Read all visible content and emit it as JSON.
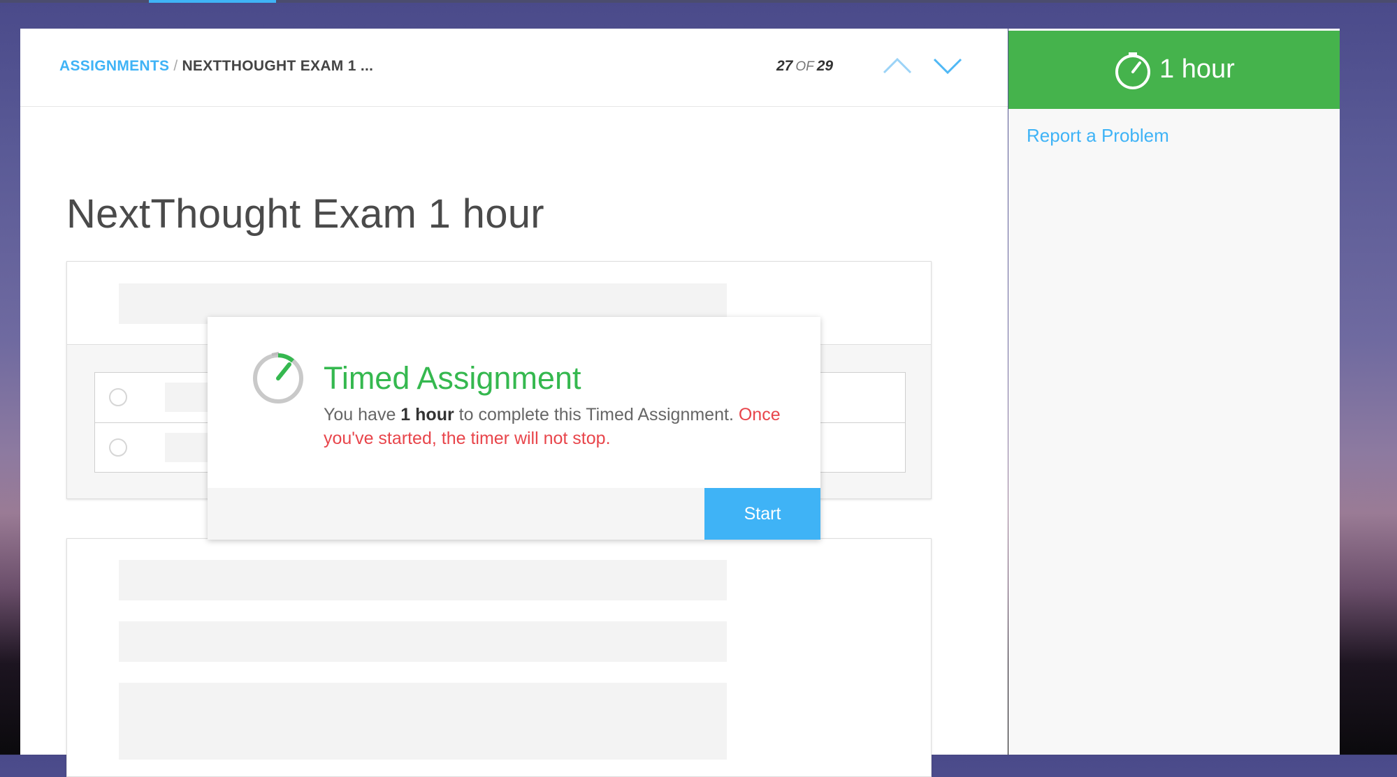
{
  "colors": {
    "accent": "#3fb3f6",
    "timer_green": "#45b34c",
    "dialog_title_green": "#35b84f",
    "warning_red": "#e8454b"
  },
  "header": {
    "breadcrumb_link": "ASSIGNMENTS",
    "breadcrumb_separator": "/",
    "breadcrumb_current": "NEXTTHOUGHT EXAM 1 ...",
    "pager_current": "27",
    "pager_of": "OF",
    "pager_total": "29",
    "icons": {
      "previous": "chevron-up-icon",
      "next": "chevron-down-icon"
    }
  },
  "assignment": {
    "title": "NextThought Exam 1 hour"
  },
  "dialog": {
    "icon": "stopwatch-icon",
    "title": "Timed Assignment",
    "text_prefix": "You have ",
    "text_duration": "1 hour",
    "text_middle": " to complete this Timed Assignment. ",
    "text_warning": "Once you've started, the timer will not stop.",
    "start_label": "Start"
  },
  "sidebar": {
    "timer_icon": "stopwatch-icon",
    "timer_label": "1 hour",
    "report_link": "Report a Problem"
  }
}
